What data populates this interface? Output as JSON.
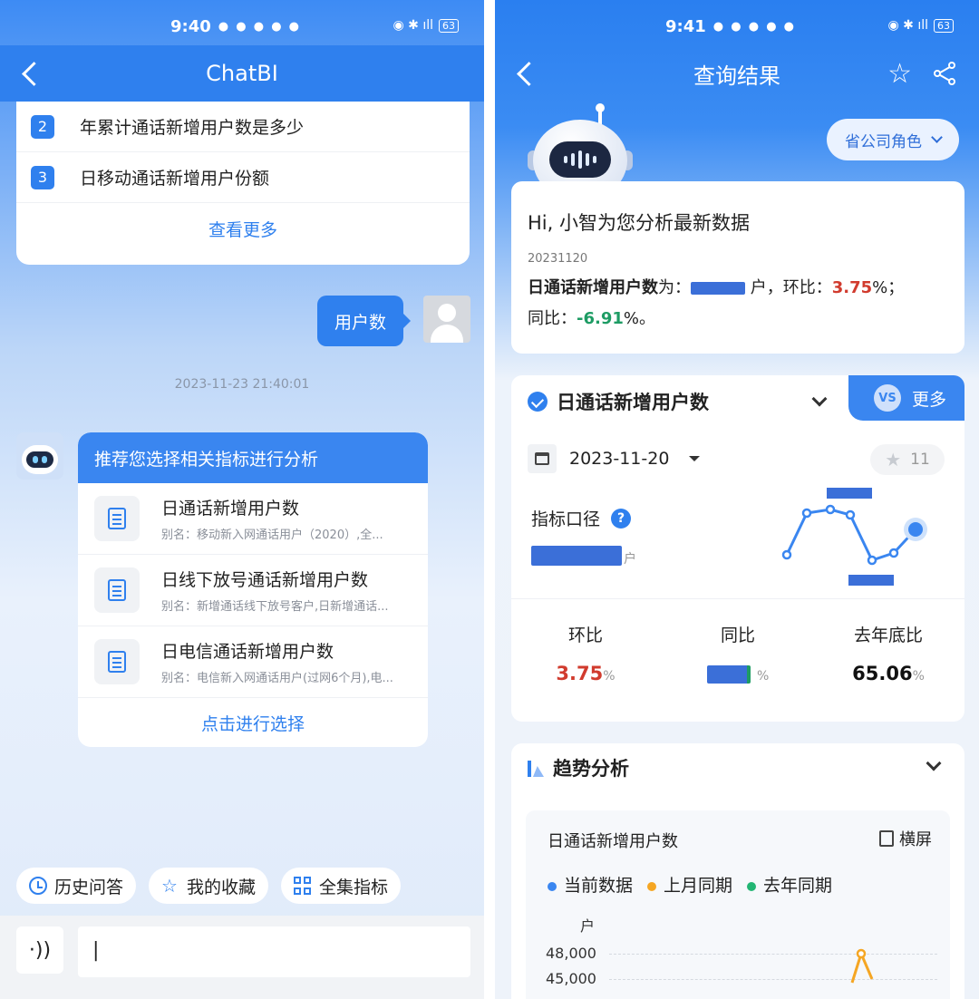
{
  "left": {
    "status": {
      "time": "9:40",
      "battery": "63"
    },
    "title": "ChatBI",
    "suggestions": [
      {
        "num": "2",
        "text": "年累计通话新增用户数是多少"
      },
      {
        "num": "3",
        "text": "日移动通话新增用户份额"
      }
    ],
    "view_more": "查看更多",
    "user_message": "用户数",
    "timestamp": "2023-11-23 21:40:01",
    "recommend": {
      "header": "推荐您选择相关指标进行分析",
      "items": [
        {
          "title": "日通话新增用户数",
          "alias": "别名：移动新入网通话用户（2020）,全..."
        },
        {
          "title": "日线下放号通话新增用户数",
          "alias": "别名：新增通话线下放号客户,日新增通话..."
        },
        {
          "title": "日电信通话新增用户数",
          "alias": "别名：电信新入网通话用户(过网6个月),电..."
        }
      ],
      "footer": "点击进行选择"
    },
    "quick": {
      "history": "历史问答",
      "favorites": "我的收藏",
      "all_metrics": "全集指标"
    },
    "input_value": "|"
  },
  "right": {
    "status": {
      "time": "9:41",
      "battery": "63"
    },
    "title": "查询结果",
    "role": "省公司角色",
    "greeting": "Hi, 小智为您分析最新数据",
    "date_code": "20231120",
    "summary": {
      "metric": "日通话新增用户数",
      "is": "为：",
      "unit": "户，环比：",
      "mom": "3.75",
      "pct1": "%；",
      "yoy_label": "同比：",
      "yoy": "-6.91",
      "pct2": "%。"
    },
    "metric": {
      "name": "日通话新增用户数",
      "vs_more": "更多",
      "vs": "VS",
      "date": "2023-11-20",
      "fav_count": "11",
      "caliber_label": "指标口径",
      "unit": "户",
      "stats": [
        {
          "label": "环比",
          "value": "3.75",
          "unit": "%"
        },
        {
          "label": "同比",
          "value": "",
          "unit": "%"
        },
        {
          "label": "去年底比",
          "value": "65.06",
          "unit": "%"
        }
      ]
    },
    "trend": {
      "title": "趋势分析",
      "chart_title": "日通话新增用户数",
      "landscape": "横屏",
      "legend": [
        {
          "name": "当前数据",
          "color": "#3a86f0"
        },
        {
          "name": "上月同期",
          "color": "#f5a623"
        },
        {
          "name": "去年同期",
          "color": "#22b573"
        }
      ],
      "y_unit": "户",
      "y_ticks": [
        "48,000",
        "45,000"
      ]
    }
  }
}
